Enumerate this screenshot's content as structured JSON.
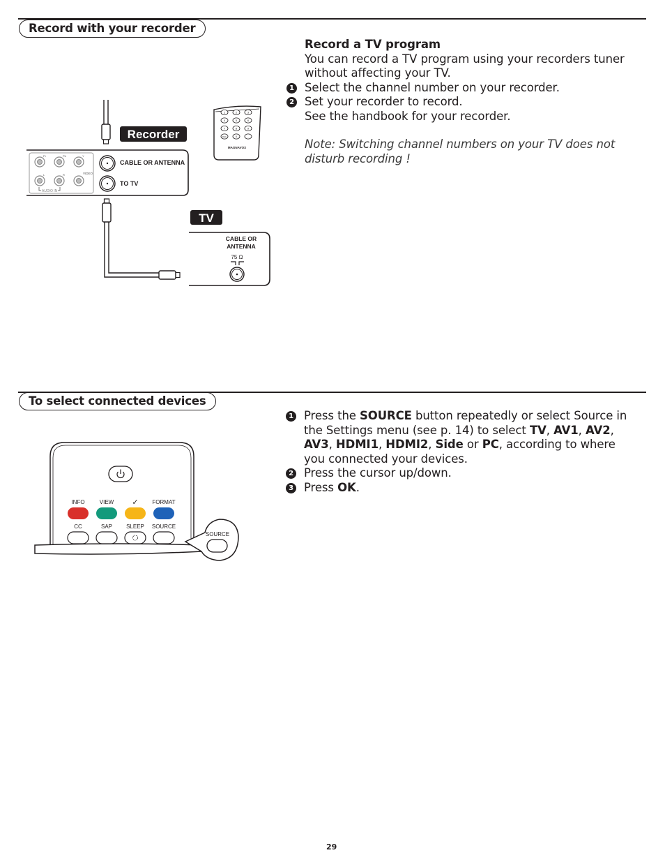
{
  "section1": {
    "title": "Record with your recorder",
    "heading": "Record a TV program",
    "intro": "You can record a TV program using your recorders tuner without affecting your TV.",
    "steps": [
      {
        "num": "1",
        "text": "Select the channel number on your recorder."
      },
      {
        "num": "2",
        "text": "Set your recorder to record."
      }
    ],
    "extra": "See the handbook for your recorder.",
    "note": "Note: Switching channel numbers on your TV does not disturb recording !",
    "diagram": {
      "recorder_label": "Recorder",
      "tv_label": "TV",
      "recorder_ports": [
        "CABLE OR ANTENNA",
        "TO TV"
      ],
      "rca_labels": [
        "Pr",
        "Pb",
        "Y",
        "L",
        "R",
        "VIDEO"
      ],
      "audio_in": "AUDIO IN",
      "tv_port_line1": "CABLE OR",
      "tv_port_line2": "ANTENNA",
      "impedance": "75 Ω",
      "remote_brand": "MAGNAVOX",
      "remote_keys": [
        "1",
        "2",
        "3",
        "4",
        "5",
        "6",
        "7",
        "8",
        "9",
        "REC",
        "0",
        "-"
      ]
    }
  },
  "section2": {
    "title": "To select connected devices",
    "steps": [
      {
        "num": "1",
        "parts": [
          {
            "t": "Press the ",
            "b": false
          },
          {
            "t": "SOURCE",
            "b": true
          },
          {
            "t": " button repeatedly or select Source in the Settings menu (see p. 14) to select ",
            "b": false
          },
          {
            "t": "TV",
            "b": true
          },
          {
            "t": ", ",
            "b": false
          },
          {
            "t": "AV1",
            "b": true
          },
          {
            "t": ", ",
            "b": false
          },
          {
            "t": "AV2",
            "b": true
          },
          {
            "t": ", ",
            "b": false
          },
          {
            "t": "AV3",
            "b": true
          },
          {
            "t": ", ",
            "b": false
          },
          {
            "t": "HDMI1",
            "b": true
          },
          {
            "t": ", ",
            "b": false
          },
          {
            "t": "HDMI2",
            "b": true
          },
          {
            "t": ", ",
            "b": false
          },
          {
            "t": "Side",
            "b": true
          },
          {
            "t": " or ",
            "b": false
          },
          {
            "t": "PC",
            "b": true
          },
          {
            "t": ", according to where you connected your devices.",
            "b": false
          }
        ]
      },
      {
        "num": "2",
        "parts": [
          {
            "t": "Press the cursor up/down.",
            "b": false
          }
        ]
      },
      {
        "num": "3",
        "parts": [
          {
            "t": "Press ",
            "b": false
          },
          {
            "t": "OK",
            "b": true
          },
          {
            "t": ".",
            "b": false
          }
        ]
      }
    ],
    "remote": {
      "top_labels": [
        "INFO",
        "VIEW",
        "✓",
        "FORMAT"
      ],
      "bottom_labels": [
        "CC",
        "SAP",
        "SLEEP",
        "SOURCE"
      ],
      "callout_label": "SOURCE",
      "colors": {
        "red": "#d9302a",
        "green": "#139a7c",
        "yellow": "#f6b518",
        "blue": "#1e62b8"
      }
    }
  },
  "page_number": "29"
}
